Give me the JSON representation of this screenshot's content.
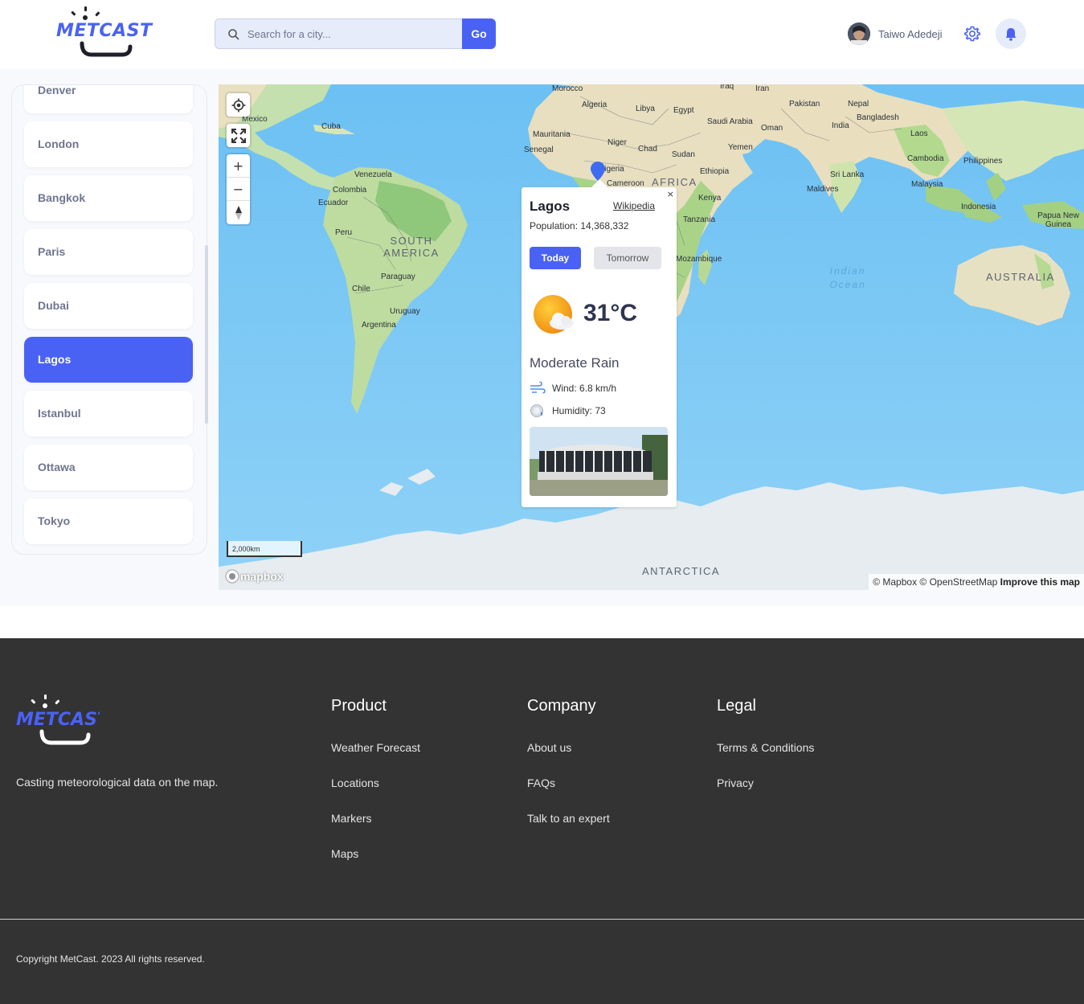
{
  "brand": {
    "name": "METCAST",
    "accent": "#4a62f3"
  },
  "search": {
    "placeholder": "Search for a city...",
    "value": "",
    "button_label": "Go"
  },
  "user": {
    "name": "Taiwo Adedeji"
  },
  "sidebar": {
    "cities": [
      {
        "label": "Denver",
        "active": false
      },
      {
        "label": "London",
        "active": false
      },
      {
        "label": "Bangkok",
        "active": false
      },
      {
        "label": "Paris",
        "active": false
      },
      {
        "label": "Dubai",
        "active": false
      },
      {
        "label": "Lagos",
        "active": true
      },
      {
        "label": "Istanbul",
        "active": false
      },
      {
        "label": "Ottawa",
        "active": false
      },
      {
        "label": "Tokyo",
        "active": false
      }
    ]
  },
  "map": {
    "labels": {
      "morocco": "Morocco",
      "algeria": "Algeria",
      "libya": "Libya",
      "egypt": "Egypt",
      "iraq": "Iraq",
      "iran": "Iran",
      "pakistan": "Pakistan",
      "nepal": "Nepal",
      "bangladesh": "Bangladesh",
      "india": "India",
      "laos": "Laos",
      "saudi": "Saudi Arabia",
      "oman": "Oman",
      "yemen": "Yemen",
      "mexico": "Mexico",
      "cuba": "Cuba",
      "mauritania": "Mauritania",
      "senegal": "Senegal",
      "niger": "Niger",
      "chad": "Chad",
      "sudan": "Sudan",
      "nigeria": "Nigeria",
      "cameroon": "Cameroon",
      "africa": "AFRICA",
      "ethiopia": "Ethiopia",
      "kenya": "Kenya",
      "tanzania": "Tanzania",
      "mozambique": "Mozambique",
      "venezuela": "Venezuela",
      "colombia": "Colombia",
      "ecuador": "Ecuador",
      "peru": "Peru",
      "south_america": "SOUTH AMERICA",
      "paraguay": "Paraguay",
      "chile": "Chile",
      "uruguay": "Uruguay",
      "argentina": "Argentina",
      "srilanka": "Sri Lanka",
      "maldives": "Maldives",
      "cambodia": "Cambodia",
      "philippines": "Philippines",
      "malaysia": "Malaysia",
      "indonesia": "Indonesia",
      "png": "Papua New Guinea",
      "australia": "AUSTRALIA",
      "indian_ocean": "Indian Ocean",
      "antarctica": "ANTARCTICA"
    },
    "scale_label": "2,000km",
    "attribution": "© Mapbox © OpenStreetMap",
    "improve_label": "Improve this map",
    "mapbox_label": "mapbox",
    "controls": {
      "zoom_in": "+",
      "zoom_out": "−"
    }
  },
  "popup": {
    "city": "Lagos",
    "wiki_label": "Wikipedia",
    "population": "Population: 14,368,332",
    "tabs": {
      "today": "Today",
      "tomorrow": "Tomorrow"
    },
    "temperature": "31°C",
    "condition": "Moderate Rain",
    "wind_label": "Wind:",
    "wind_value": "6.8 km/h",
    "humidity_label": "Humidity:",
    "humidity_value": "73",
    "close": "×"
  },
  "footer": {
    "tagline": "Casting meteorological data on the map.",
    "columns": [
      {
        "title": "Product",
        "links": [
          "Weather Forecast",
          "Locations",
          "Markers",
          "Maps"
        ]
      },
      {
        "title": "Company",
        "links": [
          "About us",
          "FAQs",
          "Talk to an expert"
        ]
      },
      {
        "title": "Legal",
        "links": [
          "Terms & Conditions",
          "Privacy"
        ]
      }
    ],
    "copyright": "Copyright MetCast. 2023 All rights reserved."
  }
}
